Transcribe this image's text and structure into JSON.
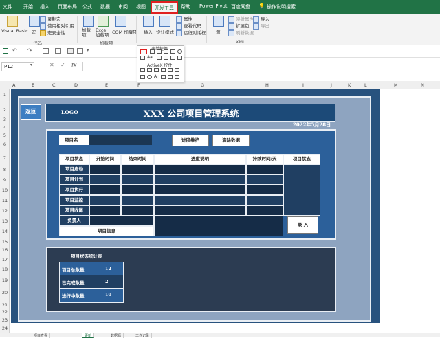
{
  "ribbon": {
    "tabs": [
      "文件",
      "开始",
      "插入",
      "页面布局",
      "公式",
      "数据",
      "审阅",
      "视图",
      "开发工具",
      "帮助",
      "Power Pivot",
      "百度网盘"
    ],
    "active_tab": "开发工具",
    "search_placeholder": "操作说明搜索",
    "code": {
      "visual_basic": "Visual Basic",
      "macro": "宏",
      "record": "录制宏",
      "relative": "使用相对引用",
      "security": "宏安全性",
      "group": "代码"
    },
    "addins": {
      "addin": "加载项",
      "excel_addin": "Excel 加载项",
      "com_addin": "COM 加载项",
      "addin_btn": "加载项",
      "group": "加载项"
    },
    "controls": {
      "insert": "插入",
      "design_mode": "设计模式",
      "properties": "属性",
      "view_code": "查看代码",
      "run_dialog": "运行对话框",
      "group": "表单控件"
    },
    "xml": {
      "source": "源",
      "map_props": "映射属性",
      "expansion": "扩展包",
      "refresh": "刷新数据",
      "import": "导入",
      "export": "导出",
      "group": "XML"
    }
  },
  "dropdown": {
    "form_controls": "表单控件",
    "activex": "ActiveX 控件"
  },
  "formula_bar": {
    "name_box": "P12",
    "fx": "fx",
    "cancel": "✕",
    "enter": "✓"
  },
  "columns": [
    "A",
    "B",
    "C",
    "D",
    "E",
    "F",
    "G",
    "H",
    "I",
    "J",
    "K",
    "L",
    "M",
    "N",
    "O"
  ],
  "rows": [
    "1",
    "2",
    "3",
    "4",
    "5",
    "6",
    "7",
    "8",
    "9",
    "10",
    "11",
    "12",
    "13",
    "14",
    "15",
    "16",
    "17",
    "18",
    "19",
    "20",
    "21",
    "22",
    "23",
    "24",
    "25",
    "26"
  ],
  "dashboard": {
    "back_button": "返回",
    "logo": "LOGO",
    "title": "XXX 公司项目管理系统",
    "date": "2022年5月28日",
    "project_name_label": "项目名",
    "progress_button": "进度维护",
    "clear_button": "清除数据",
    "submit_button": "录 入",
    "table_headers": [
      "项目状态",
      "开始时间",
      "结束时间",
      "进度说明",
      "持续时间/天",
      "项目状态"
    ],
    "stage_rows": [
      "项目启动",
      "项目计划",
      "项目执行",
      "项目监控",
      "项目收尾"
    ],
    "owner_label": "负责人",
    "info_label": "项目信息",
    "stats": {
      "title": "项目状态统计表",
      "rows": [
        {
          "label": "项目总数量",
          "value": "12"
        },
        {
          "label": "已完成数量",
          "value": "2"
        },
        {
          "label": "进行中数量",
          "value": "10"
        }
      ]
    }
  },
  "sheet_tabs": [
    "项目查看",
    "更新",
    "数据源",
    "工作记录"
  ],
  "colors": {
    "excel_green": "#217346",
    "highlight_red": "#e02020",
    "dashboard_bg": "#28527e",
    "panel": "#2c609a"
  }
}
